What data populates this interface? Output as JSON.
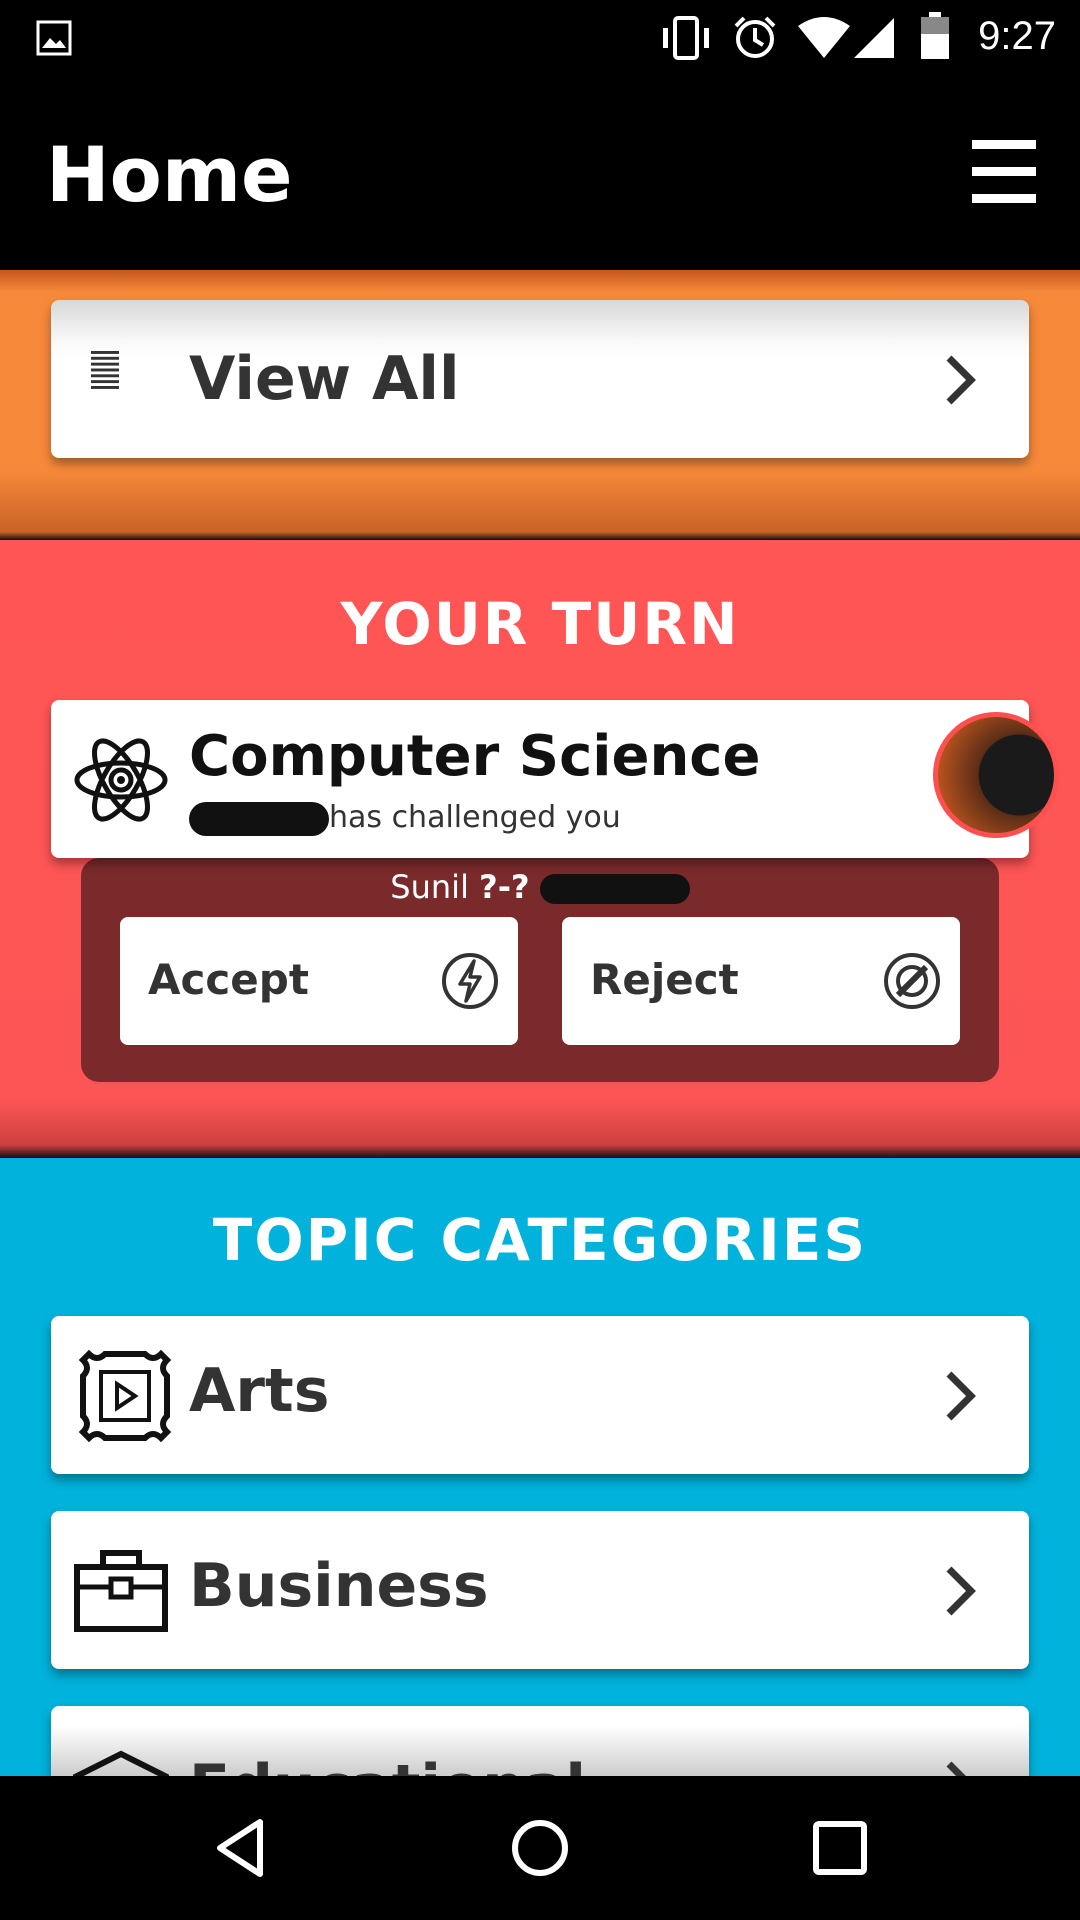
{
  "status_bar": {
    "time": "9:27"
  },
  "header": {
    "title": "Home"
  },
  "view_all": {
    "label": "View All"
  },
  "your_turn": {
    "heading": "YOUR TURN",
    "challenge": {
      "topic": "Computer Science",
      "subtitle": "has challenged you",
      "score_prefix": "Sunil",
      "score": "?-?",
      "accept_label": "Accept",
      "reject_label": "Reject"
    }
  },
  "topics": {
    "heading": "TOPIC CATEGORIES",
    "items": [
      {
        "label": "Arts",
        "icon": "picture-frame-icon"
      },
      {
        "label": "Business",
        "icon": "briefcase-icon"
      },
      {
        "label": "Educational",
        "icon": "graduation-cap-icon"
      }
    ]
  },
  "colors": {
    "orange": "#f7893a",
    "red": "#fd5555",
    "blue": "#00b2dc",
    "panel": "#7a2a2a"
  }
}
